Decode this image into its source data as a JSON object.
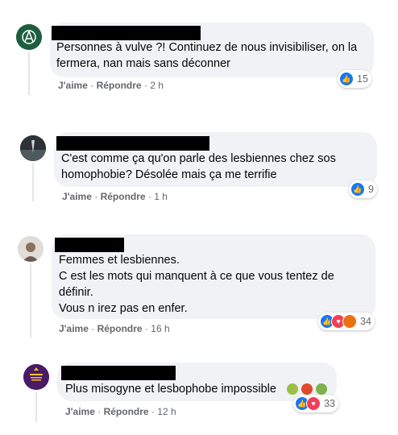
{
  "actions": {
    "like": "J'aime",
    "reply": "Répondre",
    "sep": "·"
  },
  "comments": [
    {
      "text": "Personnes à vulve ?! Continuez de nous invisibiliser, on la fermera, nan mais sans déconner",
      "time": "2 h",
      "reaction_count": "15",
      "reactions": [
        "like"
      ]
    },
    {
      "text": "C'est comme ça qu'on parle des lesbiennes chez sos homophobie? Désolée mais ça me terrifie",
      "time": "1 h",
      "reaction_count": "9",
      "reactions": [
        "like"
      ]
    },
    {
      "text": "Femmes et lesbiennes.\nC est les mots qui manquent à ce que vous tentez de définir.\nVous n irez pas en enfer.",
      "time": "16 h",
      "reaction_count": "34",
      "reactions": [
        "like",
        "love",
        "angry"
      ]
    },
    {
      "text": "Plus misogyne et lesbophobe impossible",
      "time": "12 h",
      "reaction_count": "33",
      "reactions": [
        "like",
        "love"
      ],
      "emojis": [
        "face-vomiting-icon",
        "face-swearing-icon",
        "face-sick-icon"
      ]
    }
  ],
  "colors": {
    "like": "#1877f2",
    "love": "#f33e58",
    "angry": "#e9710f",
    "bubble": "#f0f2f5",
    "meta": "#65676b"
  }
}
